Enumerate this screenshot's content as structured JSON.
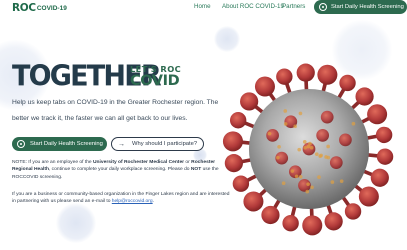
{
  "header": {
    "logo_main": "ROC",
    "logo_sub": "COVID-19",
    "nav": [
      "Home",
      "About ROC COVID-19",
      "Partners"
    ],
    "cta_label": "Start Daily Health Screening"
  },
  "hero": {
    "title": "TOGETHER",
    "lets_roc": "LET'S ROC",
    "covid": "COVID",
    "paragraph_1": "Help us keep tabs on COVID-19 in the Greater Rochester region. The",
    "paragraph_2": "better we track it, the faster we can all get back to our lives.",
    "primary_button": "Start Daily Health Screening",
    "secondary_button": "Why should I participate?",
    "secondary_arrow": "→"
  },
  "notes": {
    "note_prefix": "NOTE: If you are an employee of the ",
    "urmc": "University of Rochester Medical Center",
    "or": " or ",
    "rrh": "Rochester Regional Health",
    "note_mid": ", continue to complete your daily workplace screening. Please do ",
    "not": "NOT",
    "note_end": " use the ROCCOVID screening.",
    "partner_text": "If you are a business or community-based organization in the Finger Lakes region and are interested in partnering with us please send an e-mail to ",
    "email": "help@roccovid.org",
    "period": "."
  },
  "colors": {
    "brand_green": "#2d6a4f",
    "navy": "#243b4a",
    "virus_red": "#b23a3a",
    "link_blue": "#2a62b8"
  }
}
